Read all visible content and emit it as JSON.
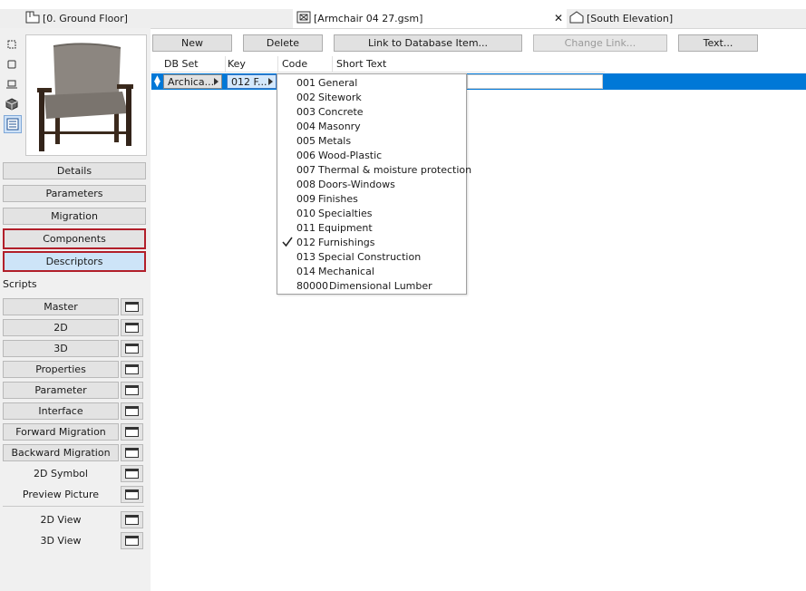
{
  "tabs": [
    {
      "label": "[0. Ground Floor]",
      "icon": "floor-plan-icon"
    },
    {
      "label": "[Armchair 04 27.gsm]",
      "icon": "library-part-icon",
      "active": true,
      "close": "✕"
    },
    {
      "label": "[South Elevation]",
      "icon": "elevation-icon"
    }
  ],
  "left_panel": {
    "nav_buttons": [
      "Details",
      "Parameters",
      "Migration",
      "Components",
      "Descriptors"
    ],
    "scripts_label": "Scripts",
    "script_buttons": [
      "Master",
      "2D",
      "3D",
      "Properties",
      "Parameter",
      "Interface",
      "Forward Migration",
      "Backward Migration",
      "2D Symbol",
      "Preview Picture"
    ],
    "view_buttons": [
      "2D View",
      "3D View"
    ]
  },
  "toolbar": {
    "new": "New",
    "delete": "Delete",
    "link": "Link to Database Item...",
    "change_link": "Change Link...",
    "text": "Text..."
  },
  "table": {
    "columns": [
      "DB Set",
      "Key",
      "Code",
      "Short Text"
    ],
    "row": {
      "db_set": "Archica...",
      "key": "012  F..."
    }
  },
  "menu": {
    "selected_code": "012",
    "items": [
      {
        "code": "001",
        "text": "General"
      },
      {
        "code": "002",
        "text": "Sitework"
      },
      {
        "code": "003",
        "text": "Concrete"
      },
      {
        "code": "004",
        "text": "Masonry"
      },
      {
        "code": "005",
        "text": "Metals"
      },
      {
        "code": "006",
        "text": "Wood-Plastic"
      },
      {
        "code": "007",
        "text": "Thermal & moisture protection"
      },
      {
        "code": "008",
        "text": "Doors-Windows"
      },
      {
        "code": "009",
        "text": "Finishes"
      },
      {
        "code": "010",
        "text": "Specialties"
      },
      {
        "code": "011",
        "text": "Equipment"
      },
      {
        "code": "012",
        "text": "Furnishings"
      },
      {
        "code": "013",
        "text": "Special Construction"
      },
      {
        "code": "014",
        "text": "Mechanical"
      },
      {
        "code": "80000",
        "text": "Dimensional Lumber"
      }
    ]
  },
  "colors": {
    "selection": "#0078d7",
    "highlight_border": "#b21f2a",
    "active_nav": "#cde4f8"
  }
}
